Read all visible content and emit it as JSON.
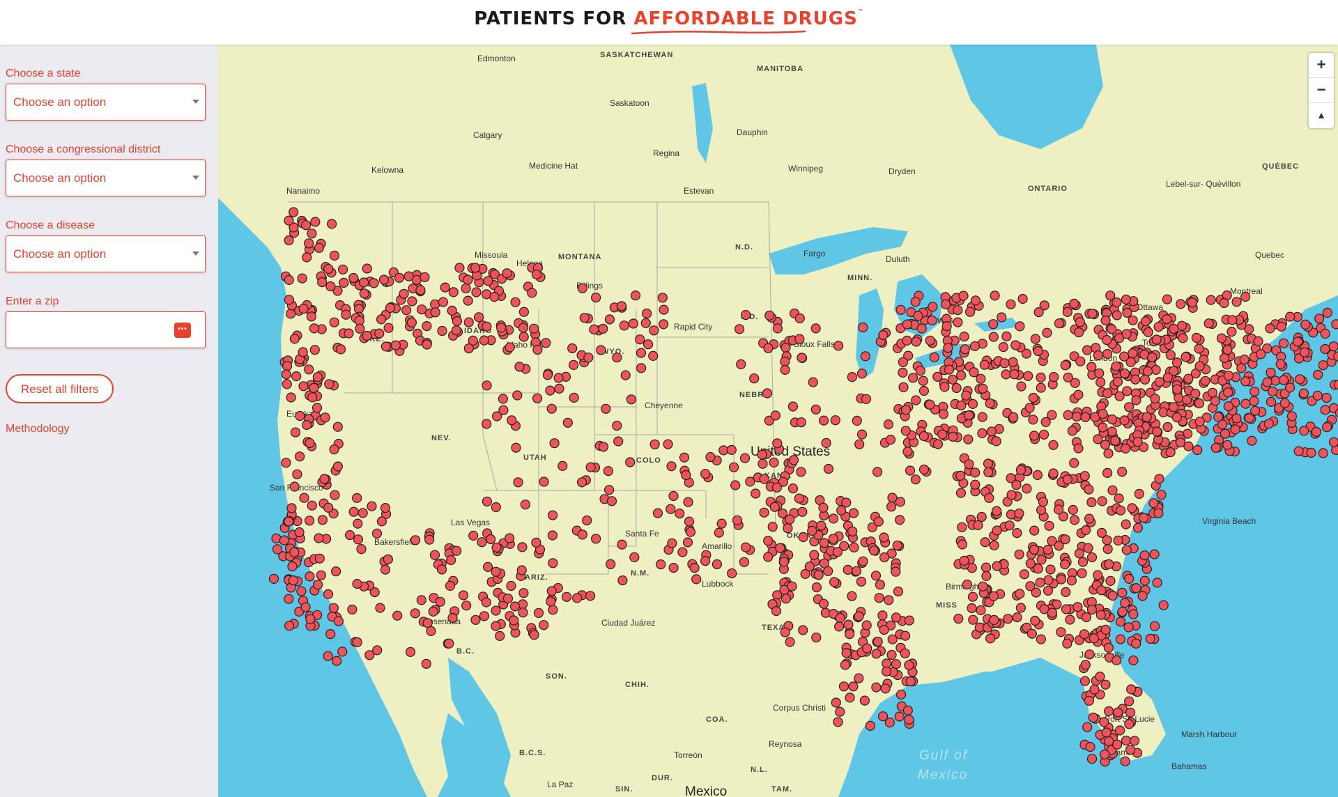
{
  "header": {
    "logo_part1": "PATIENTS FOR ",
    "logo_part2": "AFFORDABLE DRUGS",
    "logo_tm": "™"
  },
  "filters": {
    "state_label": "Choose a state",
    "state_value": "Choose an option",
    "district_label": "Choose a congressional district",
    "district_value": "Choose an option",
    "disease_label": "Choose a disease",
    "disease_value": "Choose an option",
    "zip_label": "Enter a zip",
    "zip_value": "",
    "reset_label": "Reset all filters",
    "methodology_label": "Methodology"
  },
  "map": {
    "zoom_in": "+",
    "zoom_out": "−",
    "compass": "▲",
    "marker_color": "#f0545a",
    "water_color": "#5fc6e6",
    "land_color": "#eef0c2",
    "labels": {
      "edmonton": "Edmonton",
      "saskatchewan": "SASKATCHEWAN",
      "manitoba": "MANITOBA",
      "saskatoon": "Saskatoon",
      "calgary": "Calgary",
      "dauphin": "Dauphin",
      "regina": "Regina",
      "kelowna": "Kelowna",
      "medicine_hat": "Medicine Hat",
      "winnipeg": "Winnipeg",
      "dryden": "Dryden",
      "quebec_prov": "QUÉBEC",
      "nanaimo": "Nanaimo",
      "estevan": "Estevan",
      "ontario": "ONTARIO",
      "lebel": "Lebel-sur-\nQuévillon",
      "nd": "N.D.",
      "montana": "MONTANA",
      "missoula": "Missoula",
      "helena": "Helena",
      "billings": "Billings",
      "duluth": "Duluth",
      "fargo": "Fargo",
      "quebec_city": "Quebec",
      "ottawa": "Ottawa",
      "montreal": "Montreal",
      "minn": "MINN.",
      "sd": "S.D.",
      "rapid_city": "Rapid City",
      "idaho": "IDAHO",
      "ore": "ORE.",
      "idaho_falls": "Idaho Falls",
      "wyo": "WYO.",
      "sioux_falls": "Sioux Falls",
      "wis": "WIS.",
      "toronto": "Toronto",
      "london": "London",
      "cheyenne": "Cheyenne",
      "nebr": "NEBR.",
      "eureka": "Eureka",
      "nev": "NEV.",
      "united_states": "United States",
      "colo": "COLO",
      "utah": "UTAH",
      "kans": "KANS.",
      "san_francisco": "San Francisco",
      "las_vegas": "Las Vegas",
      "santa_fe": "Santa Fe",
      "amarillo": "Amarillo",
      "bakersfield": "Bakersfield",
      "nm": "N.M.",
      "ariz": "ARIZ.",
      "lubbock": "Lubbock",
      "okla": "OKLA.",
      "ensenada": "Ensenada",
      "ciudad_juarez": "Ciudad Juárez",
      "texas": "TEXAS",
      "miss": "MISS",
      "birmingham": "Birmingham",
      "virginia_beach": "Virginia Beach",
      "bc": "B.C.",
      "son": "SON.",
      "chih": "CHIH.",
      "jacksonville": "Jacksonville",
      "coa": "COA.",
      "corpus_christi": "Corpus Christi",
      "port_st_lucie": "Port St. Lucie",
      "marsh_harbour": "Marsh Harbour",
      "miami": "Miami",
      "bcs": "B.C.S.",
      "torreon": "Torreón",
      "gulf": "Gulf of",
      "mexico_gulf": "Mexico",
      "bahamas": "Bahamas",
      "dur": "DUR.",
      "nl": "N.L.",
      "la_paz": "La Paz",
      "sin": "SIN.",
      "tam": "TAM.",
      "mexico": "Mexico",
      "reynosa": "Reynosa"
    }
  }
}
